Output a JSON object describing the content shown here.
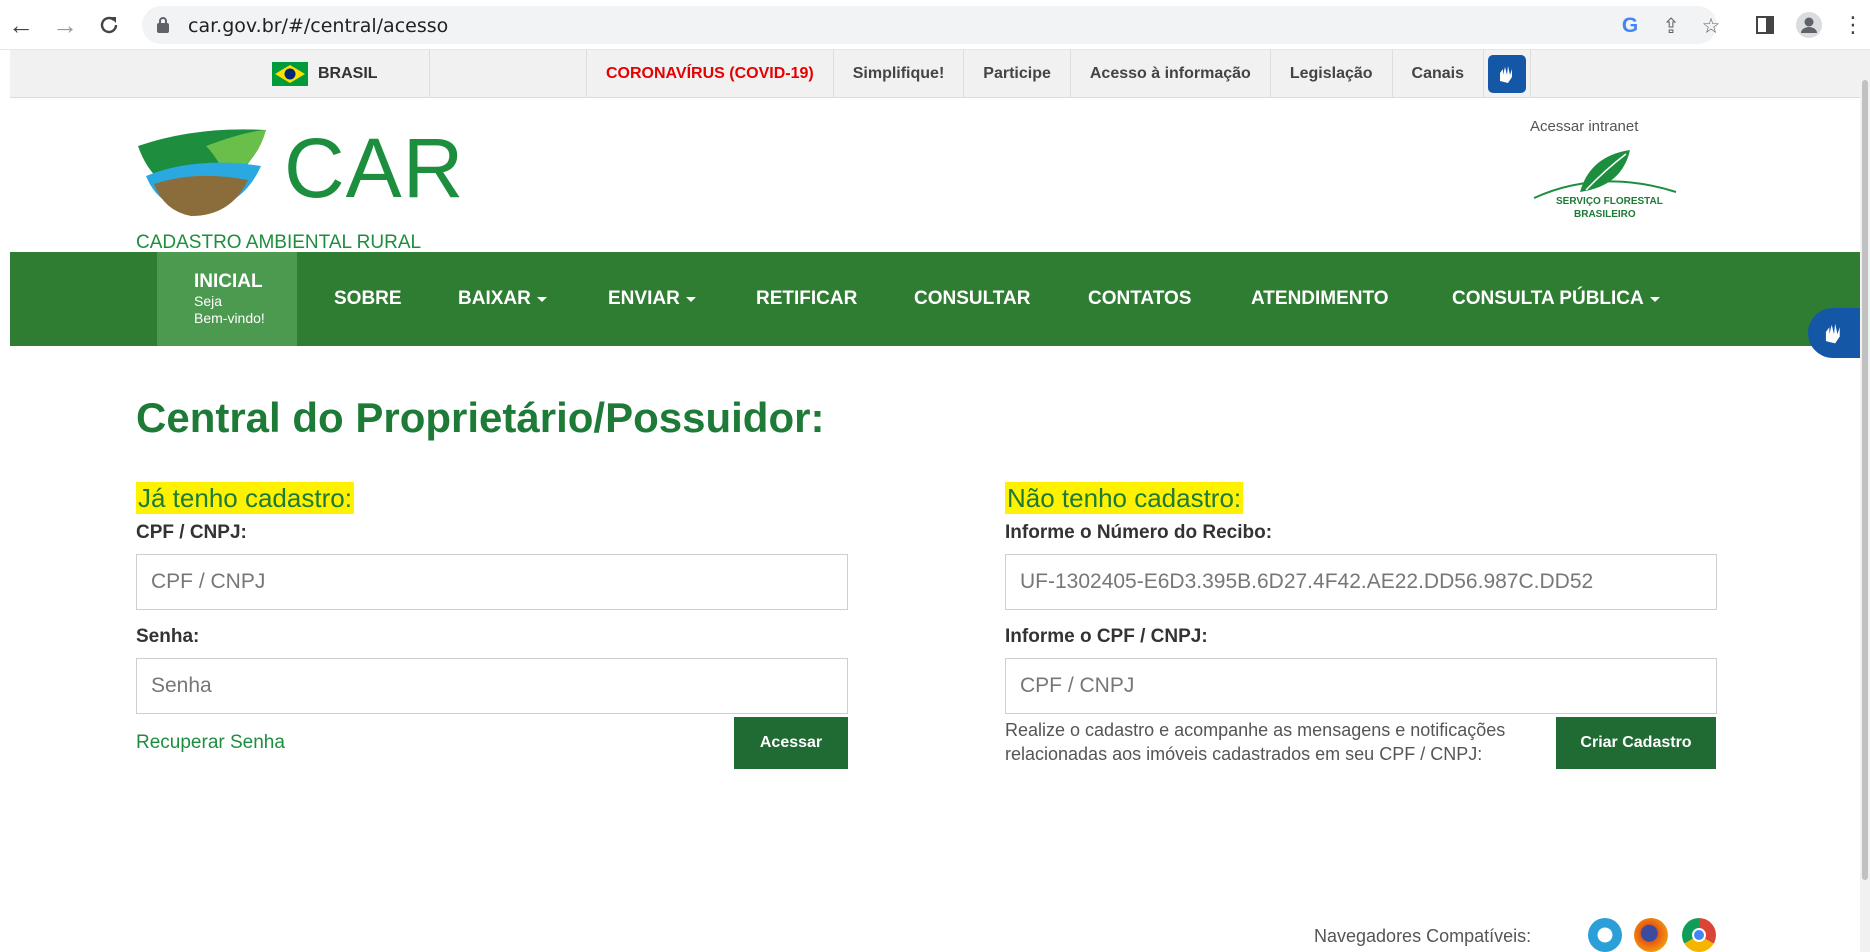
{
  "browser": {
    "url": "car.gov.br/#/central/acesso"
  },
  "govbar": {
    "country": "BRASIL",
    "links": [
      "CORONAVÍRUS (COVID-19)",
      "Simplifique!",
      "Participe",
      "Acesso à informação",
      "Legislação",
      "Canais"
    ]
  },
  "header": {
    "logo_text": "CAR",
    "logo_sub": "CADASTRO AMBIENTAL RURAL",
    "intranet": "Acessar intranet",
    "sfb_line1": "SERVIÇO FLORESTAL",
    "sfb_line2": "BRASILEIRO"
  },
  "menu": {
    "home_title": "INICIAL",
    "home_sub1": "Seja",
    "home_sub2": "Bem-vindo!",
    "items": [
      "SOBRE",
      "BAIXAR",
      "ENVIAR",
      "RETIFICAR",
      "CONSULTAR",
      "CONTATOS",
      "ATENDIMENTO",
      "CONSULTA PÚBLICA"
    ]
  },
  "page": {
    "title": "Central do Proprietário/Possuidor:"
  },
  "login": {
    "heading": "Já tenho cadastro:",
    "cpf_label": "CPF / CNPJ:",
    "cpf_placeholder": "CPF / CNPJ",
    "senha_label": "Senha:",
    "senha_placeholder": "Senha",
    "recover": "Recuperar Senha",
    "submit": "Acessar"
  },
  "register": {
    "heading": "Não tenho cadastro:",
    "recibo_label": "Informe o Número do Recibo:",
    "recibo_value": "UF-1302405-E6D3.395B.6D27.4F42.AE22.DD56.987C.DD52",
    "cpf_label": "Informe o CPF / CNPJ:",
    "cpf_placeholder": "CPF / CNPJ",
    "desc_line1": "Realize o cadastro e acompanhe as mensagens e notificações",
    "desc_line2": "relacionadas aos imóveis cadastrados em seu CPF / CNPJ:",
    "submit": "Criar Cadastro"
  },
  "footer": {
    "compat": "Navegadores Compatíveis:"
  },
  "colors": {
    "green_dark": "#2e7d32",
    "green_text": "#1d7a37",
    "highlight": "#fff200",
    "covid_red": "#e60000"
  }
}
